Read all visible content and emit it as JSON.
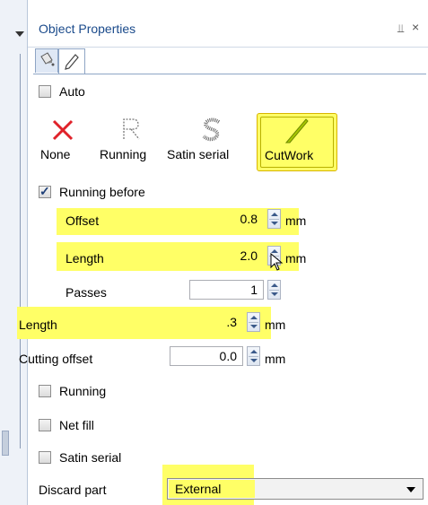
{
  "panel": {
    "title": "Object Properties",
    "pin_glyph": "$",
    "close_glyph": "×"
  },
  "tabs": [
    {
      "icon": "fill-bucket-icon"
    },
    {
      "icon": "pencil-icon"
    }
  ],
  "auto": {
    "label": "Auto",
    "checked": false
  },
  "stitch_types": [
    {
      "label": "None",
      "icon": "none-x-icon"
    },
    {
      "label": "Running",
      "icon": "running-stitch-icon"
    },
    {
      "label": "Satin serial",
      "icon": "satin-serial-icon"
    },
    {
      "label": "CutWork",
      "icon": "cutwork-blade-icon",
      "selected": true
    }
  ],
  "running_before": {
    "label": "Running before",
    "checked": true,
    "offset": {
      "label": "Offset",
      "value": "0.8",
      "unit": "mm"
    },
    "length": {
      "label": "Length",
      "value": "2.0",
      "unit": "mm"
    },
    "passes": {
      "label": "Passes",
      "value": "1"
    }
  },
  "length": {
    "label": "Length",
    "value": ".3",
    "unit": "mm"
  },
  "cutting_offset": {
    "label": "Cutting offset",
    "value": "0.0",
    "unit": "mm"
  },
  "running": {
    "label": "Running",
    "checked": false
  },
  "net_fill": {
    "label": "Net fill",
    "checked": false
  },
  "satin_serial": {
    "label": "Satin serial",
    "checked": false
  },
  "discard_part": {
    "label": "Discard part",
    "value": "External"
  },
  "colors": {
    "highlight": "#ffff66",
    "title": "#1a4a8b",
    "none_x": "#e0222a",
    "cutwork_blade": "#a8c800"
  }
}
